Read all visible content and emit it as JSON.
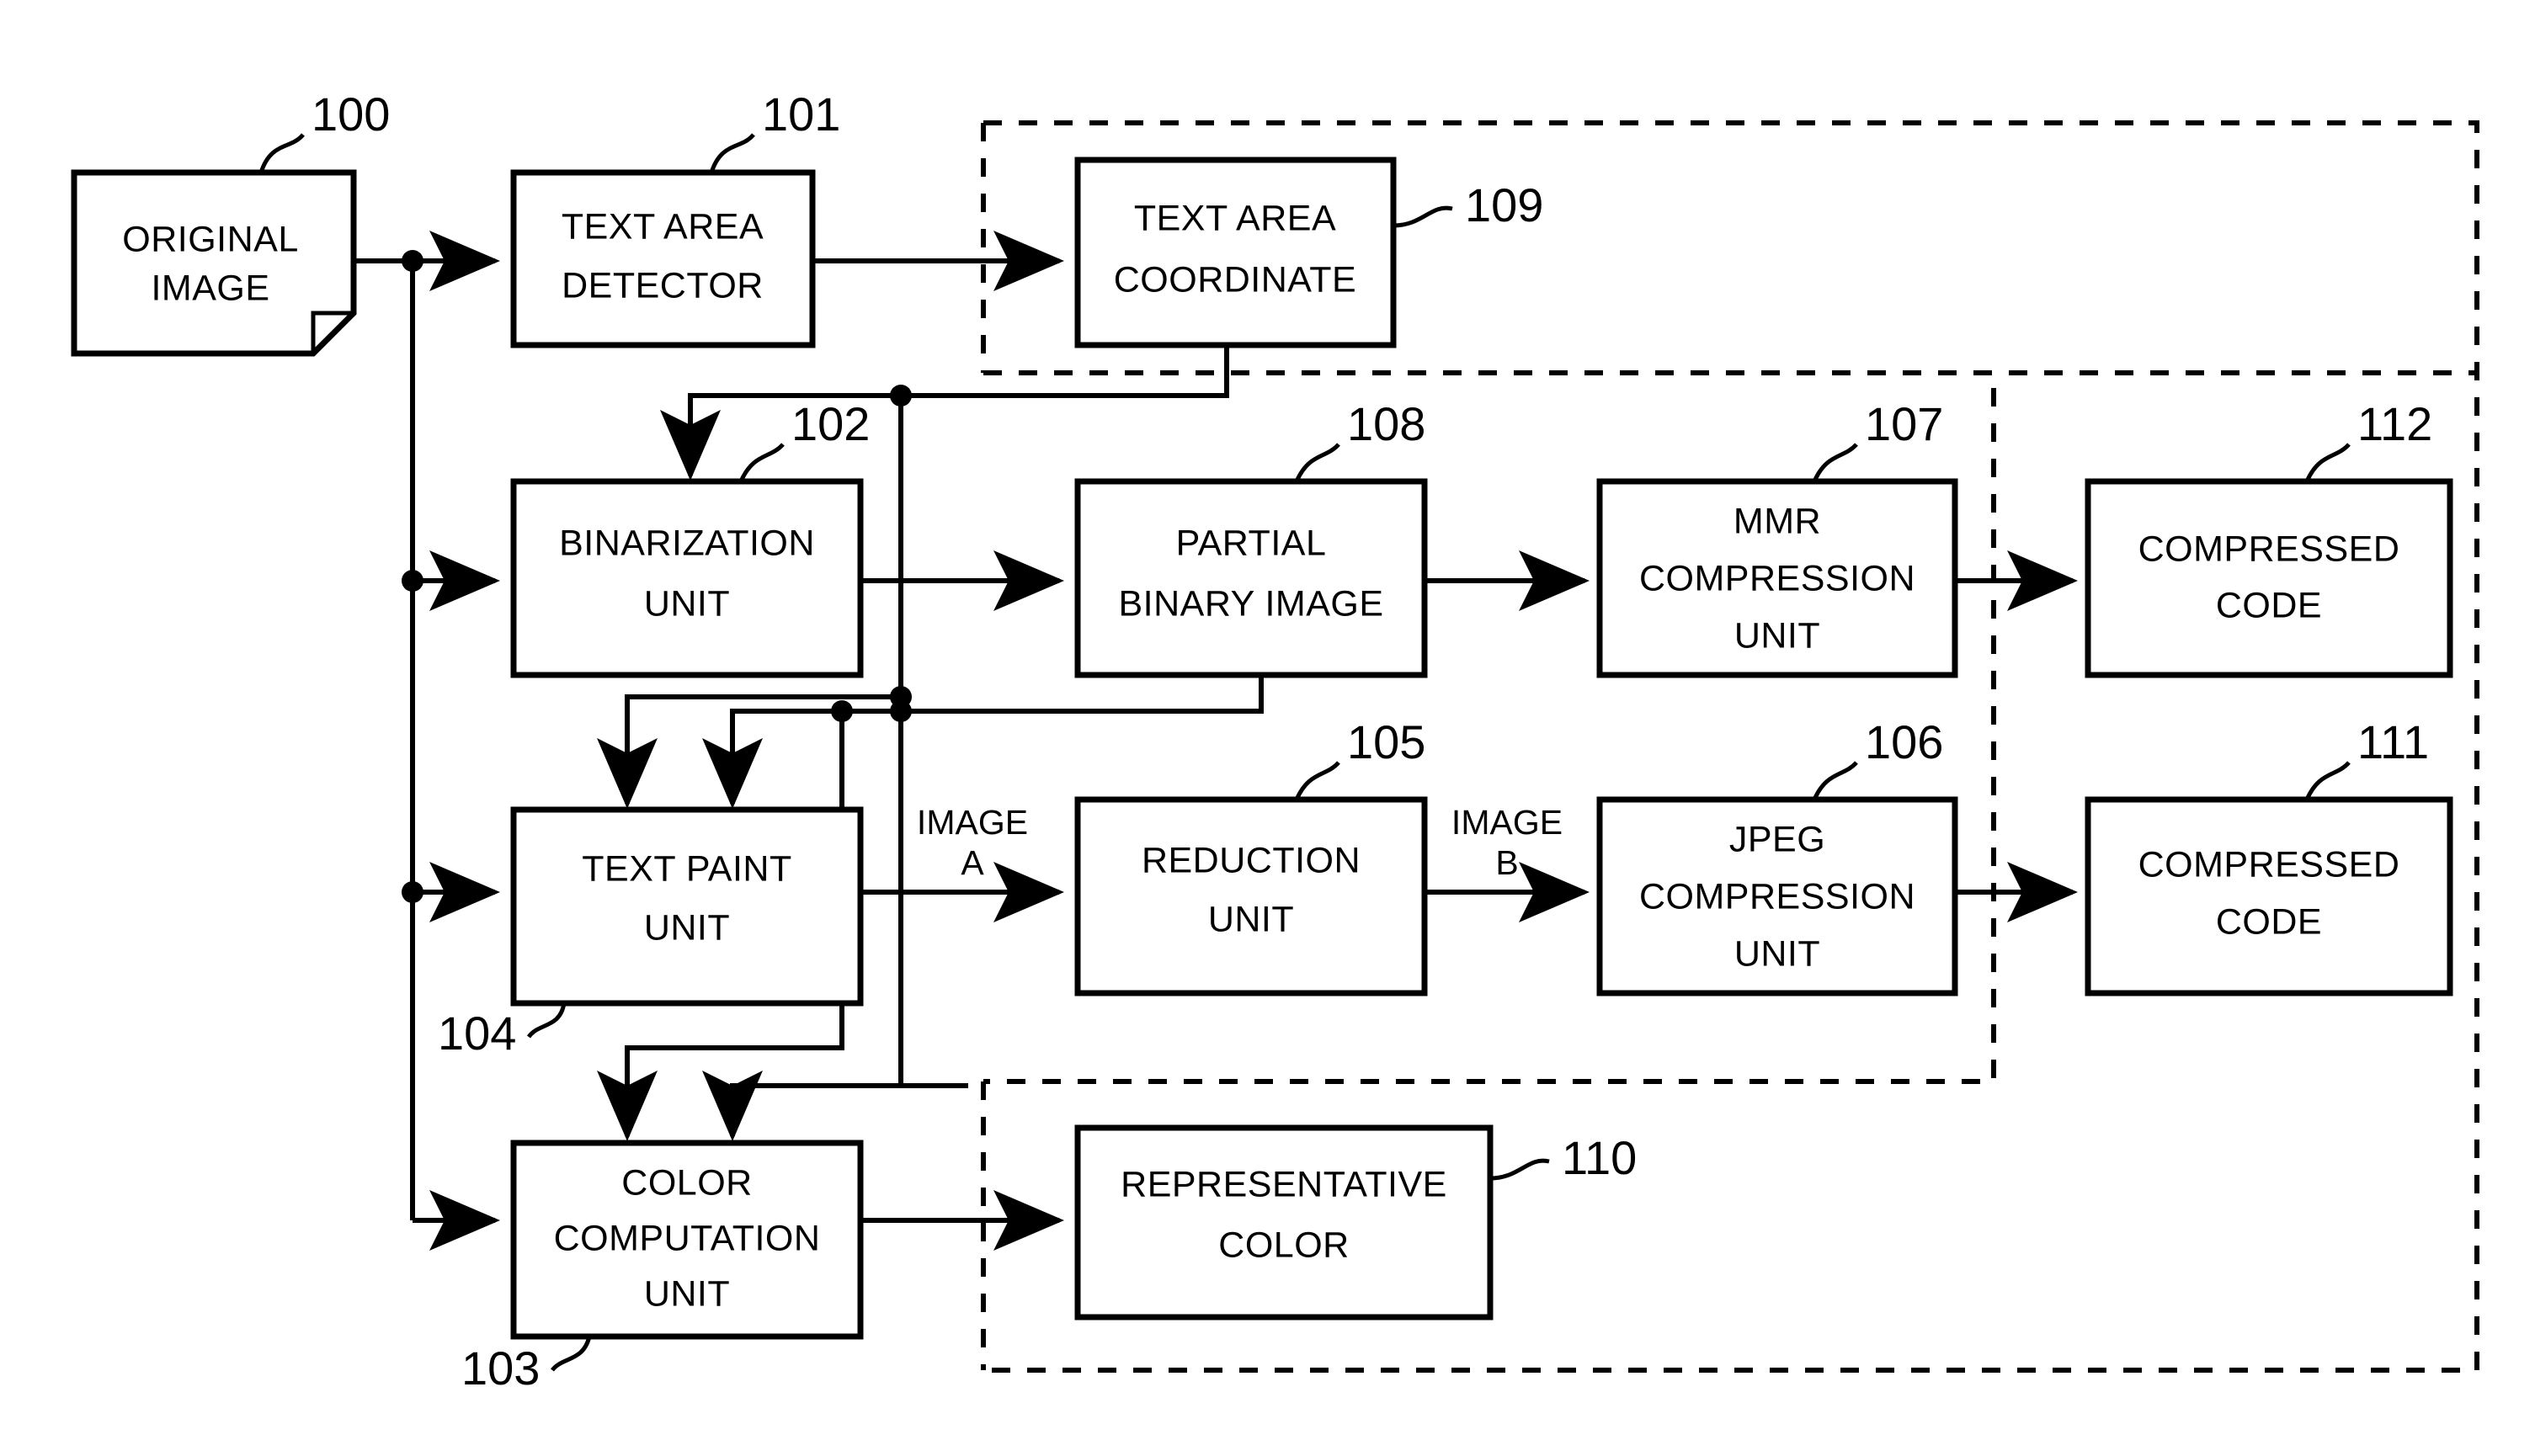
{
  "figure": {
    "type": "block-diagram",
    "title": "Image compression block diagram",
    "background_color": "#ffffff",
    "line_color": "#000000"
  },
  "blocks": [
    {
      "id": "100",
      "ref": "100",
      "label_line1": "ORIGINAL",
      "label_line2": "IMAGE",
      "shape": "document"
    },
    {
      "id": "101",
      "ref": "101",
      "label_line1": "TEXT AREA",
      "label_line2": "DETECTOR",
      "shape": "rect"
    },
    {
      "id": "109",
      "ref": "109",
      "label_line1": "TEXT AREA",
      "label_line2": "COORDINATE",
      "shape": "rect"
    },
    {
      "id": "102",
      "ref": "102",
      "label_line1": "BINARIZATION",
      "label_line2": "UNIT",
      "shape": "rect"
    },
    {
      "id": "108",
      "ref": "108",
      "label_line1": "PARTIAL",
      "label_line2": "BINARY IMAGE",
      "shape": "rect"
    },
    {
      "id": "107",
      "ref": "107",
      "label_line1": "MMR",
      "label_line2": "COMPRESSION",
      "label_line3": "UNIT",
      "shape": "rect"
    },
    {
      "id": "112",
      "ref": "112",
      "label_line1": "COMPRESSED",
      "label_line2": "CODE",
      "shape": "rect"
    },
    {
      "id": "104",
      "ref": "104",
      "label_line1": "TEXT PAINT",
      "label_line2": "UNIT",
      "shape": "rect"
    },
    {
      "id": "105",
      "ref": "105",
      "label_line1": "REDUCTION",
      "label_line2": "UNIT",
      "shape": "rect"
    },
    {
      "id": "106",
      "ref": "106",
      "label_line1": "JPEG",
      "label_line2": "COMPRESSION",
      "label_line3": "UNIT",
      "shape": "rect"
    },
    {
      "id": "111",
      "ref": "111",
      "label_line1": "COMPRESSED",
      "label_line2": "CODE",
      "shape": "rect"
    },
    {
      "id": "103",
      "ref": "103",
      "label_line1": "COLOR",
      "label_line2": "COMPUTATION",
      "label_line3": "UNIT",
      "shape": "rect"
    },
    {
      "id": "110",
      "ref": "110",
      "label_line1": "REPRESENTATIVE",
      "label_line2": "COLOR",
      "shape": "rect"
    }
  ],
  "signal_labels": [
    {
      "id": "image_a",
      "line1": "IMAGE",
      "line2": "A"
    },
    {
      "id": "image_b",
      "line1": "IMAGE",
      "line2": "B"
    }
  ],
  "reference_numerals": [
    "100",
    "101",
    "109",
    "102",
    "108",
    "107",
    "112",
    "104",
    "105",
    "106",
    "111",
    "103",
    "110"
  ],
  "dashed_regions": [
    {
      "id": "outer",
      "description": "outer dashed boundary"
    },
    {
      "id": "coordinate-region",
      "description": "dashed region around text area coordinate"
    },
    {
      "id": "compression-region",
      "description": "dashed region around compression chain"
    }
  ]
}
